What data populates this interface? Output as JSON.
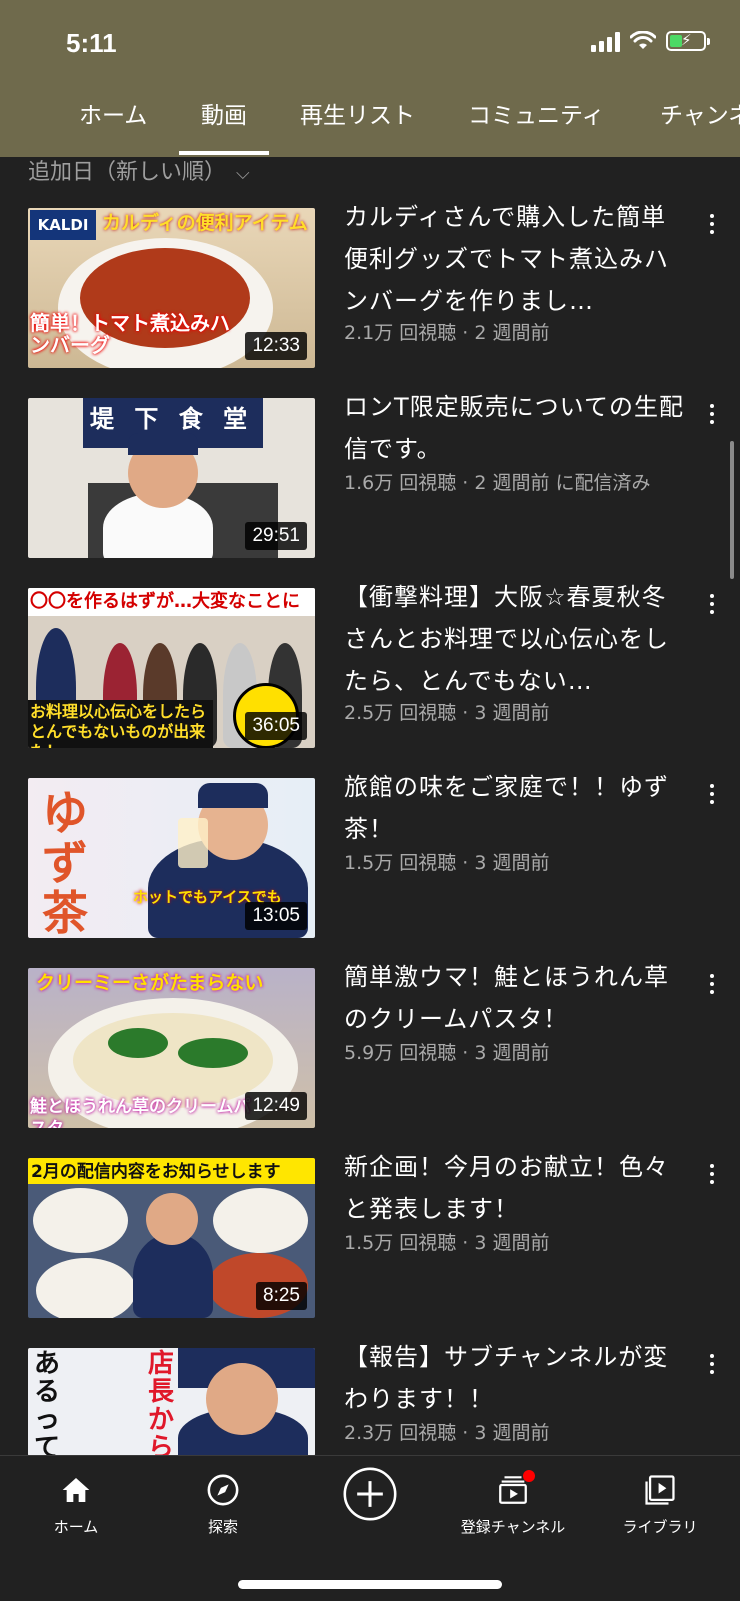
{
  "status": {
    "time": "5:11"
  },
  "tabs": [
    {
      "label": "ホーム"
    },
    {
      "label": "動画"
    },
    {
      "label": "再生リスト"
    },
    {
      "label": "コミュニティ"
    },
    {
      "label": "チャンネ"
    }
  ],
  "sort": {
    "label": "追加日（新しい順）"
  },
  "videos": [
    {
      "title": "カルディさんで購入した簡単便利グッズでトマト煮込みハンバーグを作りまし…",
      "meta": "2.1万 回視聴 · 2 週間前",
      "duration": "12:33",
      "thumb_text_top": "カルディの便利アイテム",
      "thumb_text_bottom": "簡単！トマト煮込みハンバーグ",
      "thumb_logo": "KALDI"
    },
    {
      "title": "ロンT限定販売についての生配信です。",
      "meta": "1.6万 回視聴 · 2 週間前 に配信済み",
      "duration": "29:51",
      "thumb_text_top": "堤 下 食 堂"
    },
    {
      "title": "【衝撃料理】大阪☆春夏秋冬さんとお料理で以心伝心をしたら、とんでもない…",
      "meta": "2.5万 回視聴 · 3 週間前",
      "duration": "36:05",
      "thumb_text_top": "〇〇を作るはずが…大変なことに",
      "thumb_text_bottom": "お料理以心伝心をしたらとんでもないものが出来た！"
    },
    {
      "title": "旅館の味をご家庭で！！ゆず茶！",
      "meta": "1.5万 回視聴 · 3 週間前",
      "duration": "13:05",
      "thumb_text_top": "ゆず茶",
      "thumb_text_bottom": "ホットでもアイスでも"
    },
    {
      "title": "簡単激ウマ！鮭とほうれん草のクリームパスタ！",
      "meta": "5.9万 回視聴 · 3 週間前",
      "duration": "12:49",
      "thumb_text_top": "クリーミーさがたまらない",
      "thumb_text_bottom": "鮭とほうれん草のクリームパスタ"
    },
    {
      "title": "新企画！今月のお献立！色々と発表します！",
      "meta": "1.5万 回視聴 · 3 週間前",
      "duration": "8:25",
      "thumb_text_top": "2月の配信内容をお知らせします"
    },
    {
      "title": "【報告】サブチャンネルが変わります！！",
      "meta": "2.3万 回視聴 · 3 週間前",
      "duration": "",
      "thumb_text_top": "店長からお知らせ",
      "thumb_text_bottom": "あるって"
    }
  ],
  "bottom_nav": [
    {
      "label": "ホーム",
      "icon": "home-icon"
    },
    {
      "label": "探索",
      "icon": "explore-icon"
    },
    {
      "label": "",
      "icon": "create-icon"
    },
    {
      "label": "登録チャンネル",
      "icon": "subscriptions-icon"
    },
    {
      "label": "ライブラリ",
      "icon": "library-icon"
    }
  ],
  "colors": {
    "header": "#6f6a4c",
    "background": "#212121",
    "notification_dot": "#ff0000"
  }
}
